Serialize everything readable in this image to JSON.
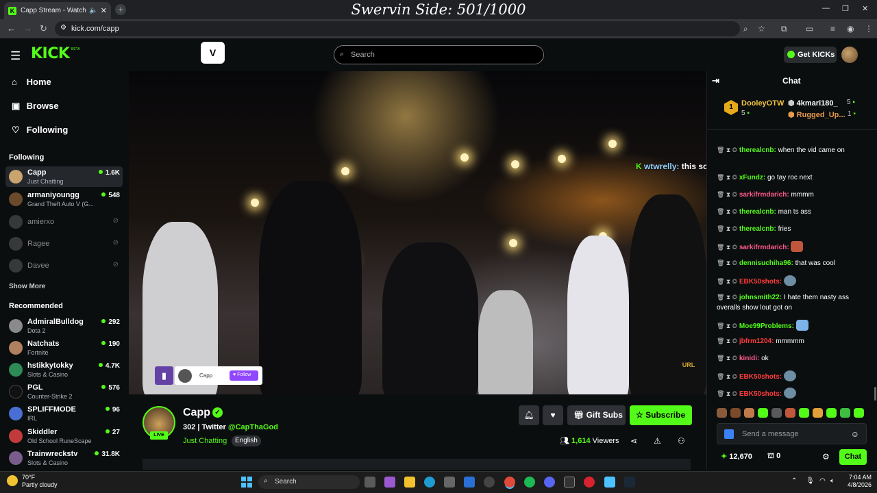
{
  "browser": {
    "tab_title": "Capp Stream - Watch Live o",
    "url": "kick.com/capp",
    "overlay_text": "Swervin Side: 501/1000"
  },
  "header": {
    "logo": "KICK",
    "beta": "BETA",
    "search_placeholder": "Search",
    "get_kicks_label": "Get KICKs",
    "v_logo": "V"
  },
  "sidebar": {
    "nav": [
      {
        "label": "Home",
        "icon": "home-icon"
      },
      {
        "label": "Browse",
        "icon": "browse-icon"
      },
      {
        "label": "Following",
        "icon": "heart-icon"
      }
    ],
    "following_header": "Following",
    "following": [
      {
        "name": "Capp",
        "category": "Just Chatting",
        "viewers": "1.6K",
        "live": true,
        "color": "#c9a46f"
      },
      {
        "name": "armaniyoungg",
        "category": "Grand Theft Auto V (G...",
        "viewers": "548",
        "live": true,
        "color": "#6b4a2b"
      },
      {
        "name": "amierxo",
        "category": "",
        "viewers": "",
        "live": false,
        "color": "#555555"
      },
      {
        "name": "Ragee",
        "category": "",
        "viewers": "",
        "live": false,
        "color": "#555555"
      },
      {
        "name": "Davee",
        "category": "",
        "viewers": "",
        "live": false,
        "color": "#555555"
      }
    ],
    "show_more": "Show More",
    "recommended_header": "Recommended",
    "recommended": [
      {
        "name": "AdmiralBulldog",
        "category": "Dota 2",
        "viewers": "292",
        "color": "#8a8a8a"
      },
      {
        "name": "Natchats",
        "category": "Fortnite",
        "viewers": "190",
        "color": "#b08060"
      },
      {
        "name": "hstikkytokky",
        "category": "Slots & Casino",
        "viewers": "4.7K",
        "color": "#2e8b57"
      },
      {
        "name": "PGL",
        "category": "Counter-Strike 2",
        "viewers": "576",
        "color": "#111111"
      },
      {
        "name": "SPLIFFMODE",
        "category": "IRL",
        "viewers": "96",
        "color": "#4a6fd4"
      },
      {
        "name": "Skiddler",
        "category": "Old School RuneScape",
        "viewers": "27",
        "color": "#c23b3b"
      },
      {
        "name": "Trainwreckstv",
        "category": "Slots & Casino",
        "viewers": "31.8K",
        "color": "#7a5c8a"
      }
    ]
  },
  "video": {
    "overlay_chat_user": "wtwrelly:",
    "overlay_chat_text": "this scheme got potential",
    "card_name": "Capp",
    "card_follow": "Follow",
    "url_badge": "URL"
  },
  "stream": {
    "channel_name": "Capp",
    "live_badge": "LIVE",
    "title_prefix": "302 | Twitter ",
    "title_handle": "@CapThaGod",
    "category": "Just Chatting",
    "language": "English",
    "gift_subs_label": "Gift Subs",
    "subscribe_label": "Subscribe",
    "viewers_count": "1,614",
    "viewers_label": "Viewers"
  },
  "chat": {
    "header": "Chat",
    "leaderboard": [
      {
        "rank": "1",
        "name": "DooleyOTW",
        "value": "5"
      },
      {
        "rank": "2",
        "name": "4kmari180_",
        "value": "5"
      },
      {
        "rank": "3",
        "name": "Rugged_Up...",
        "value": "1"
      }
    ],
    "messages": [
      {
        "user": "therealcnb:",
        "text": "when the vid came on",
        "color": "#53fc18"
      },
      {
        "user": "xFundz:",
        "text": "go tay roc next",
        "color": "#53fc18"
      },
      {
        "user": "sarkifrmdarich:",
        "text": "mmmm",
        "color": "#ff5a8a"
      },
      {
        "user": "therealcnb:",
        "text": "man ts ass",
        "color": "#53fc18"
      },
      {
        "user": "therealcnb:",
        "text": "fries",
        "color": "#53fc18"
      },
      {
        "user": "sarkifrmdarich:",
        "text": "",
        "color": "#ff5a8a"
      },
      {
        "user": "dennisuchiha96:",
        "text": "that was cool",
        "color": "#53fc18"
      },
      {
        "user": "EBK50shots:",
        "text": "",
        "color": "#ff3b3b"
      },
      {
        "user": "johnsmith22:",
        "text": "I hate them nasty ass overalls show lout got on",
        "color": "#53fc18"
      },
      {
        "user": "Moe99Problems:",
        "text": "",
        "color": "#53fc18"
      },
      {
        "user": "jbfrm1204:",
        "text": "mmmmm",
        "color": "#ff3b3b"
      },
      {
        "user": "kinidi:",
        "text": "ok",
        "color": "#ff5a8a"
      },
      {
        "user": "EBK50shots:",
        "text": "",
        "color": "#ff3b3b"
      },
      {
        "user": "EBK50shots:",
        "text": "",
        "color": "#ff3b3b"
      }
    ],
    "input_placeholder": "Send a message",
    "points": "12,670",
    "drops": "0",
    "chat_button": "Chat"
  },
  "taskbar": {
    "temp": "70°F",
    "weather": "Partly cloudy",
    "search": "Search",
    "time": "7:04 AM",
    "date": "4/8/2026"
  }
}
